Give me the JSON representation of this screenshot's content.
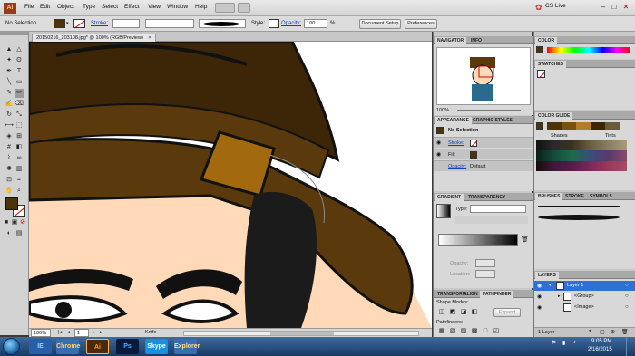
{
  "menu": {
    "logo": "Ai",
    "items": [
      "File",
      "Edit",
      "Object",
      "Type",
      "Select",
      "Effect",
      "View",
      "Window",
      "Help"
    ],
    "cs_live": "CS Live"
  },
  "control": {
    "selection": "No Selection",
    "stroke_label": "Stroke:",
    "style_label": "Style:",
    "opacity_label": "Opacity:",
    "opacity_value": "100",
    "opacity_unit": "%",
    "document_setup": "Document Setup",
    "preferences": "Preferences"
  },
  "document": {
    "tab_title": "20150216_203108.jpg* @ 100% (RGB/Preview)",
    "zoom": "100%",
    "page": "1",
    "tool_name": "Knife"
  },
  "navigator": {
    "tabs": [
      "NAVIGATOR",
      "INFO"
    ],
    "zoom": "100%"
  },
  "appearance": {
    "tabs": [
      "APPEARANCE",
      "GRAPHIC STYLES"
    ],
    "title": "No Selection",
    "stroke_label": "Stroke:",
    "fill_label": "Fill:",
    "opacity_label": "Opacity:",
    "opacity_value": "Default"
  },
  "gradient": {
    "tabs": [
      "GRADIENT",
      "TRANSPARENCY"
    ],
    "type_label": "Type:",
    "opacity_label": "Opacity:",
    "location_label": "Location:"
  },
  "pathfinder": {
    "tabs": [
      "TRANSFORM",
      "ALIGN",
      "PATHFINDER"
    ],
    "shape_modes": "Shape Modes:",
    "expand": "Expand",
    "pathfinders": "Pathfinders:"
  },
  "color": {
    "tabs": [
      "COLOR"
    ]
  },
  "swatches": {
    "tabs": [
      "SWATCHES"
    ]
  },
  "color_guide": {
    "tabs": [
      "COLOR GUIDE"
    ],
    "shades": "Shades",
    "tints": "Tints"
  },
  "brushes": {
    "tabs": [
      "BRUSHES",
      "STROKE",
      "SYMBOLS"
    ]
  },
  "layers": {
    "tabs": [
      "LAYERS"
    ],
    "rows": [
      "Layer 1",
      "<Group>",
      "<Image>"
    ],
    "footer": "1 Layer"
  },
  "taskbar": {
    "apps": [
      "IE",
      "Chrome",
      "Ai",
      "Ps",
      "Skype",
      "Explorer"
    ],
    "time": "9:05 PM",
    "date": "2/16/2015"
  },
  "colors": {
    "hat": "#5a3a0c",
    "hat_dark": "#3d2607",
    "band": "#a2690f",
    "skin": "#ffd9b8",
    "hair": "#1b1b1b",
    "accent": "#2f6fd6"
  }
}
